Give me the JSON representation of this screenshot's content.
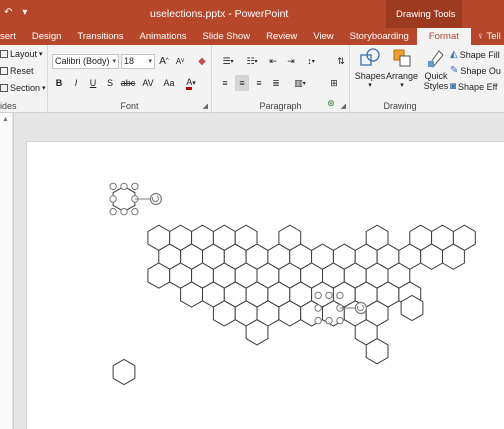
{
  "titlebar": {
    "quick_access": [
      "↶",
      "▾"
    ],
    "title": "uselections.pptx - PowerPoint",
    "context_group": "Drawing Tools"
  },
  "tabs": [
    "sert",
    "Design",
    "Transitions",
    "Animations",
    "Slide Show",
    "Review",
    "View",
    "Storyboarding",
    "Format"
  ],
  "active_tab": "Format",
  "tell_me": "Tell me",
  "slides_group": {
    "layout": "Layout",
    "reset": "Reset",
    "section": "Section",
    "label": "ides"
  },
  "font_group": {
    "font_name": "Calibri (Body)",
    "font_size": "18",
    "grow": "A",
    "shrink": "A",
    "bold": "B",
    "italic": "I",
    "underline": "U",
    "shadow": "S",
    "strike": "abc",
    "spacing": "AV",
    "case": "Aa",
    "font_color": "A",
    "label": "Font"
  },
  "paragraph_group": {
    "label": "Paragraph"
  },
  "drawing_group": {
    "shapes": "Shapes",
    "arrange": "Arrange",
    "quick_styles": "Quick\nStyles",
    "shape_fill": "Shape Fill",
    "shape_outline": "Shape Ou",
    "shape_effects": "Shape Eff",
    "label": "Drawing"
  },
  "colors": {
    "accent": "#b7472a",
    "accent_dark": "#9c3a20",
    "ribbon": "#f3f3f3",
    "handle": "#7a7a7a"
  },
  "slide": {
    "hex_grid_rows": [
      {
        "row": 0,
        "cols": [
          20
        ]
      },
      {
        "row": 1,
        "cols": [
          18,
          19
        ]
      },
      {
        "row": 2,
        "cols": [
          1,
          2,
          3,
          4,
          5,
          7,
          11,
          13,
          14,
          15
        ]
      },
      {
        "row": 3,
        "cols": [
          1,
          2,
          3,
          4,
          5,
          6,
          7,
          8,
          9,
          10,
          11,
          12,
          13,
          14
        ]
      },
      {
        "row": 4,
        "cols": [
          1,
          2,
          3,
          4,
          5,
          6,
          7,
          8,
          9,
          10,
          11,
          12
        ]
      },
      {
        "row": 5,
        "cols": [
          2,
          3,
          4,
          5,
          6,
          7,
          8,
          9,
          10,
          11,
          12
        ]
      },
      {
        "row": 6,
        "cols": [
          4,
          5,
          6,
          7,
          8,
          9,
          10,
          11
        ]
      },
      {
        "row": 7,
        "cols": [
          5,
          10
        ]
      },
      {
        "row": 8,
        "cols": [
          11
        ]
      }
    ],
    "standalone_hexes": [
      "alaska",
      "hawaii",
      "far-east"
    ],
    "selected_shapes": 2
  }
}
